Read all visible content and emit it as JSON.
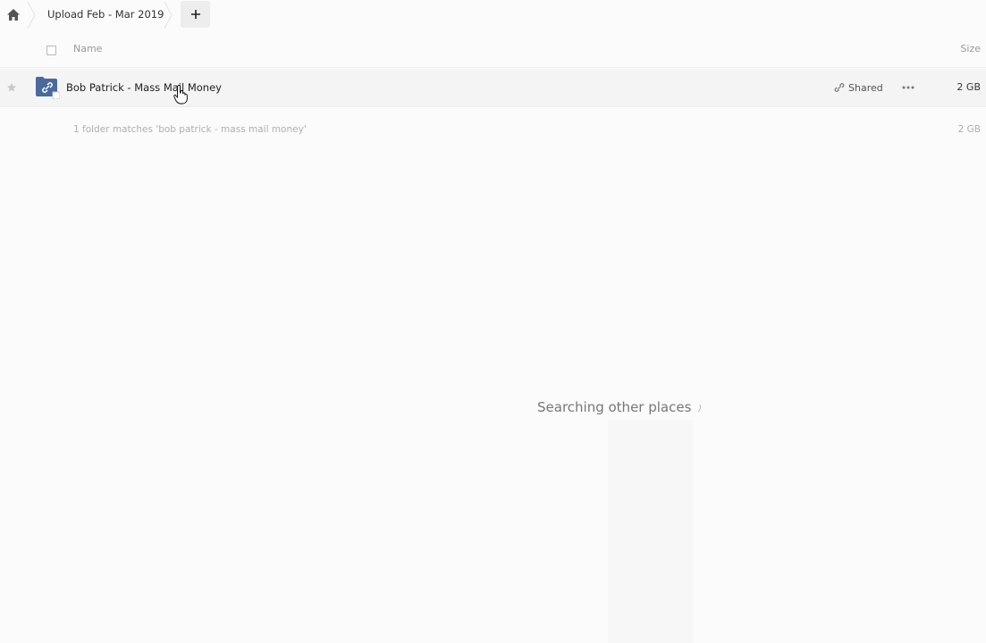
{
  "breadcrumb": {
    "home_icon": "home-icon",
    "current_folder": "Upload Feb - Mar 2019",
    "add_icon": "plus-icon"
  },
  "table": {
    "columns": {
      "name": "Name",
      "size": "Size"
    },
    "rows": [
      {
        "name": "Bob Patrick - Mass Mail Money",
        "icon": "shared-folder-icon",
        "shared_label": "Shared",
        "size": "2 GB",
        "starred": false
      }
    ],
    "summary": {
      "text": "1 folder matches 'bob patrick - mass mail money'",
      "size": "2 GB"
    }
  },
  "search_status": {
    "text": "Searching other places"
  },
  "colors": {
    "folder": "#4a6a9c",
    "background": "#fbfbfb",
    "row_hover": "#f4f4f4"
  }
}
